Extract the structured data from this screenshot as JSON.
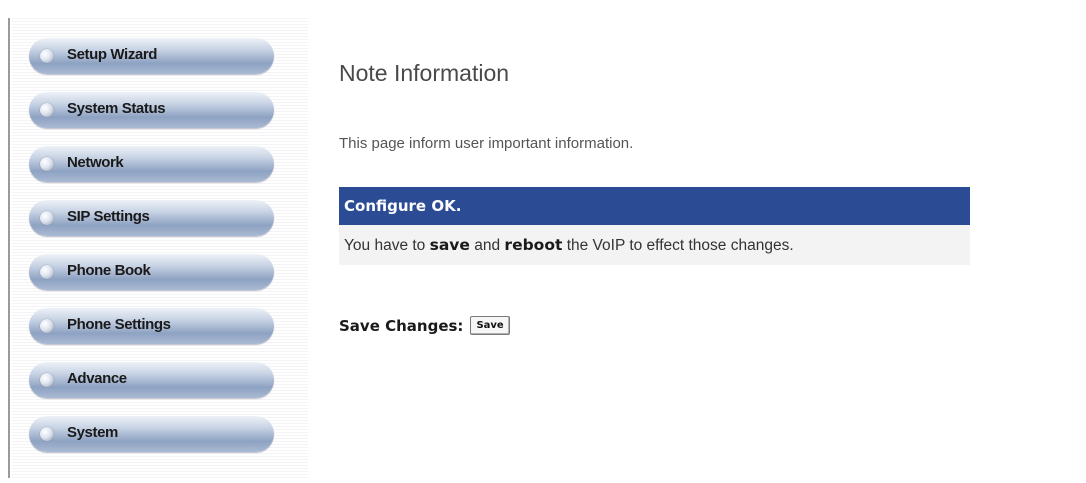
{
  "sidebar": {
    "items": [
      {
        "label": "Setup Wizard"
      },
      {
        "label": "System Status"
      },
      {
        "label": "Network"
      },
      {
        "label": "SIP Settings"
      },
      {
        "label": "Phone Book"
      },
      {
        "label": "Phone Settings"
      },
      {
        "label": "Advance"
      },
      {
        "label": "System"
      }
    ]
  },
  "main": {
    "title": "Note Information",
    "description": "This page inform user important information.",
    "message": {
      "header": "Configure OK.",
      "body_prefix": "You have to ",
      "body_save": "save",
      "body_and": " and ",
      "body_reboot": "reboot",
      "body_suffix": " the VoIP to effect those changes."
    },
    "save_changes_label": "Save Changes:",
    "save_button_label": "Save"
  },
  "colors": {
    "header_bg": "#2b4c95",
    "message_bg": "#f3f3f3"
  }
}
